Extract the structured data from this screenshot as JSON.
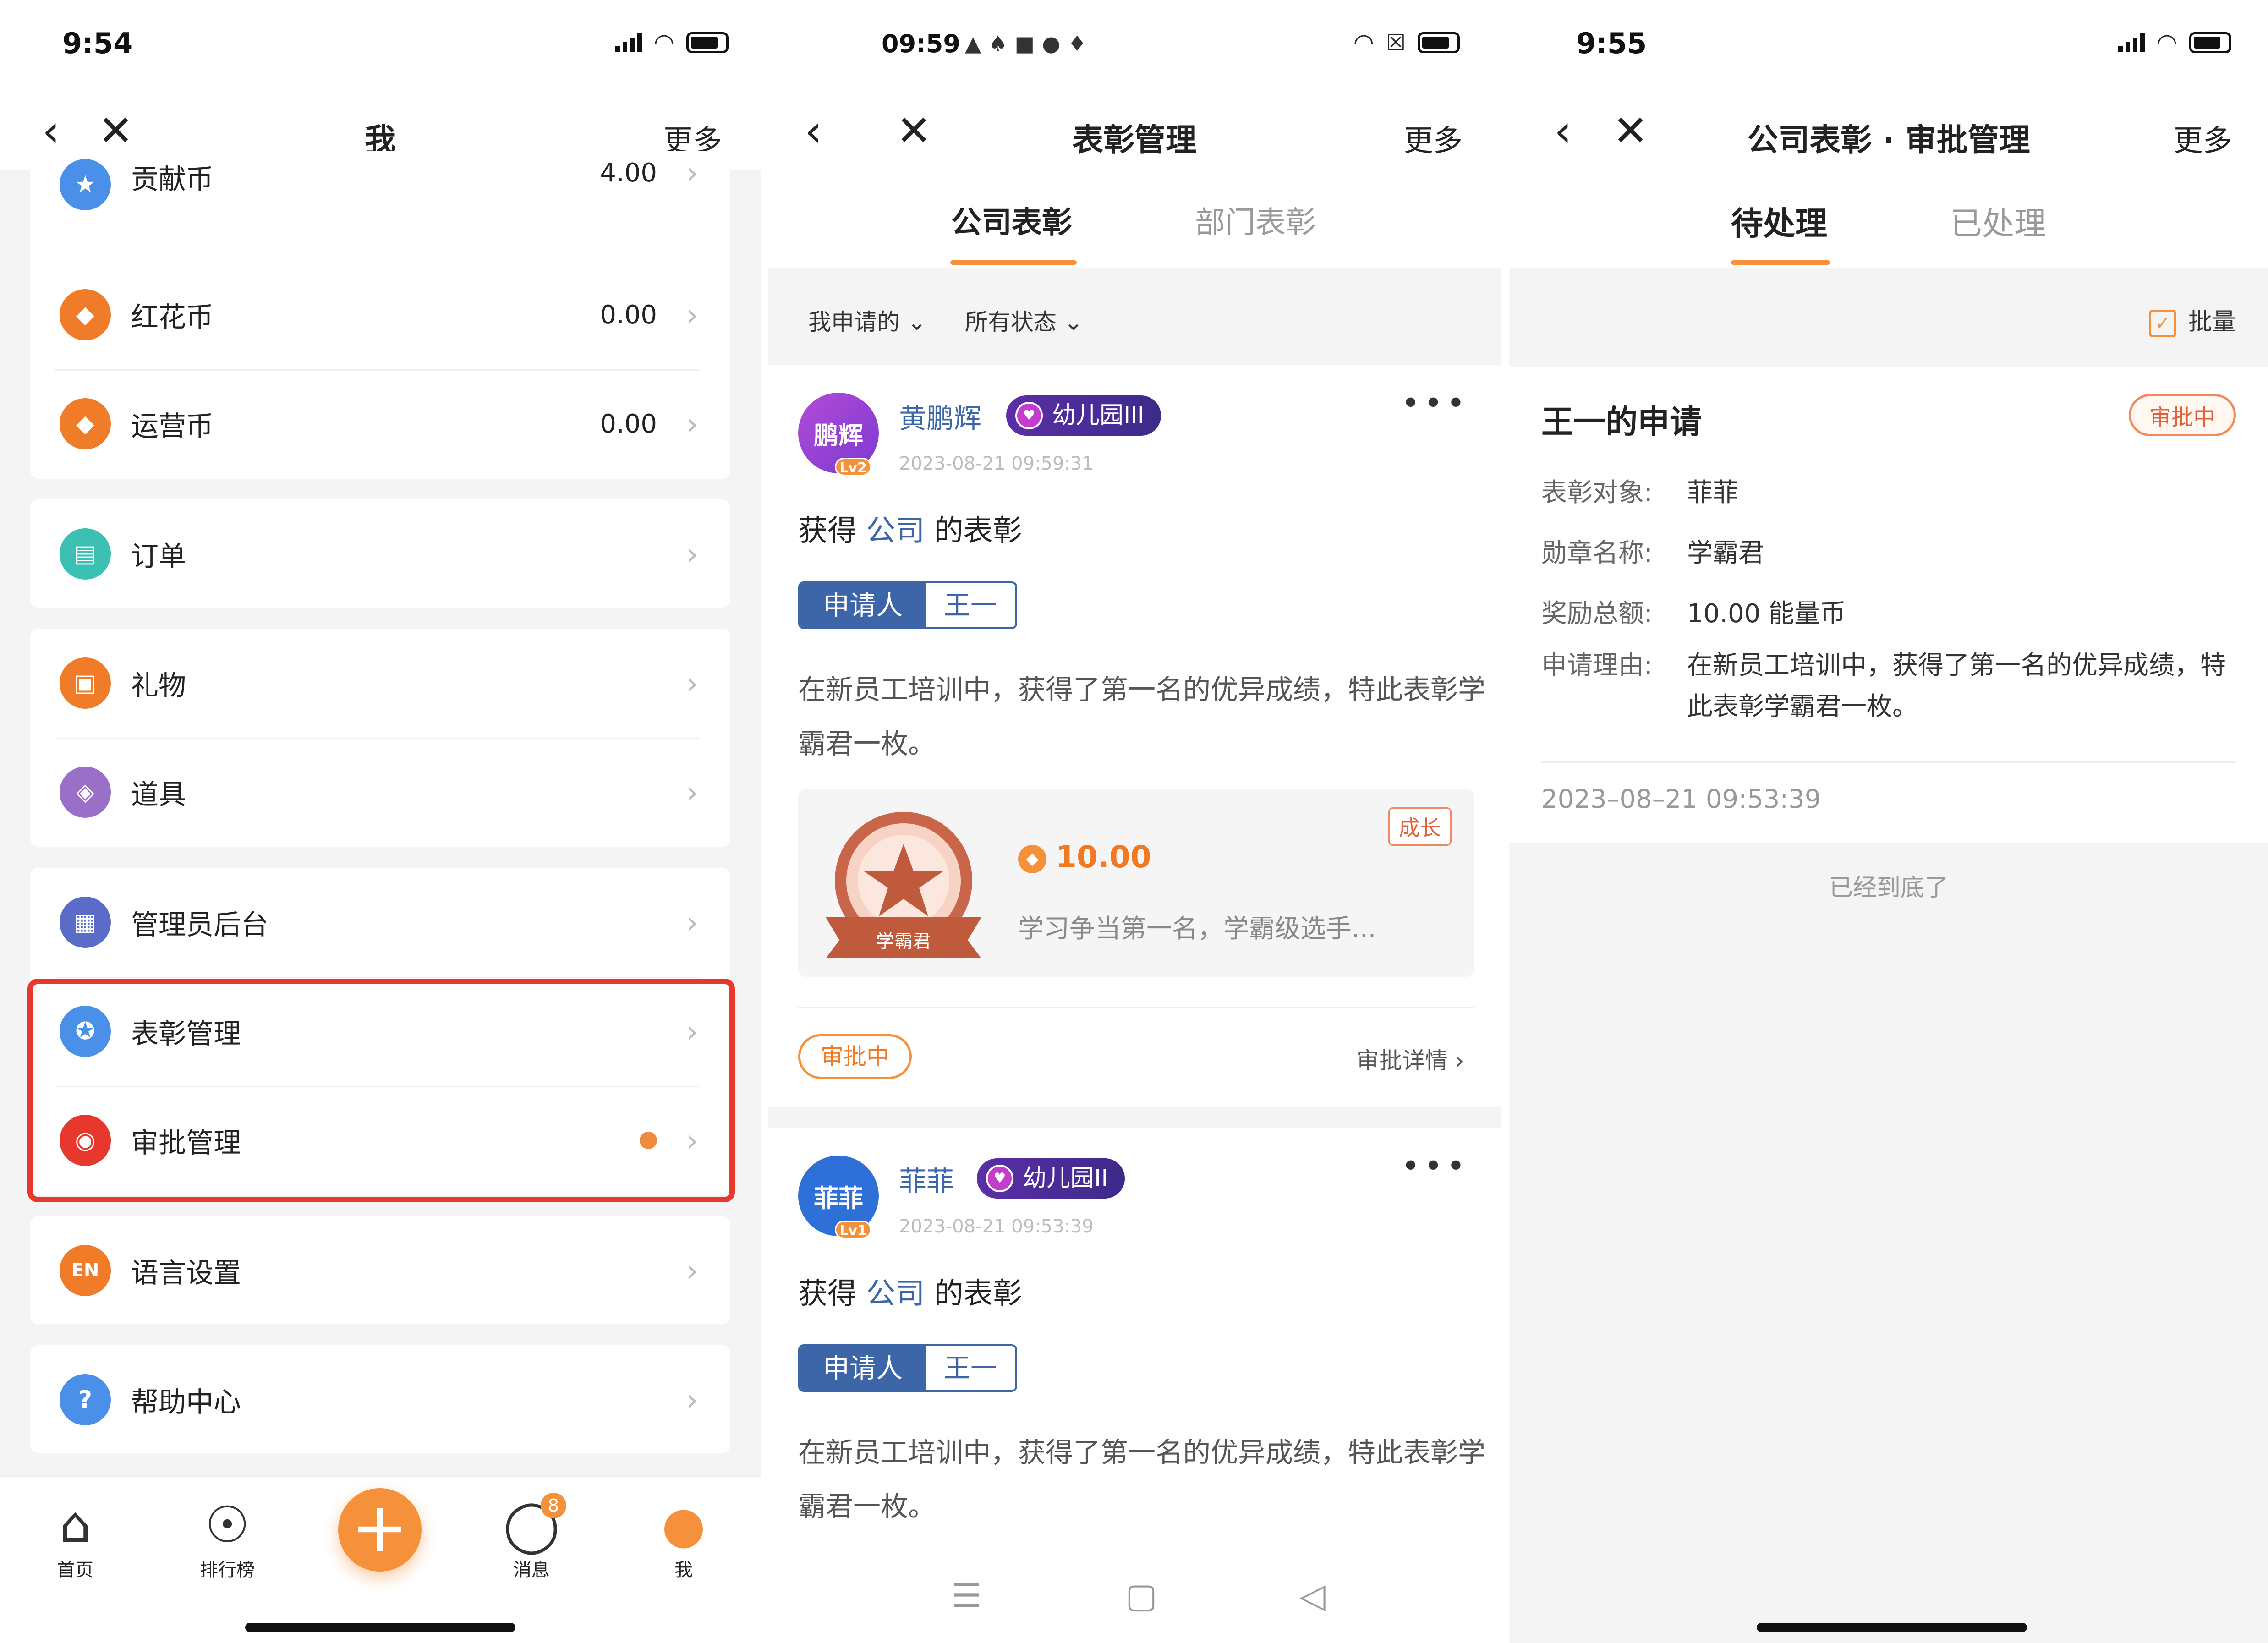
{
  "colors": {
    "accent": "#f5913a",
    "brand_blue": "#3d66a8",
    "highlight_red": "#e8382d"
  },
  "screen1": {
    "time": "9:54",
    "nav": {
      "title": "我",
      "more": "更多"
    },
    "rows": [
      {
        "label": "贡献币",
        "value": "4.00",
        "icon": "star-icon",
        "color": "#4a90e8"
      },
      {
        "label": "红花币",
        "value": "0.00",
        "icon": "diamond-icon",
        "color": "#f07c2a"
      },
      {
        "label": "运营币",
        "value": "0.00",
        "icon": "diamond-icon",
        "color": "#f07c2a"
      },
      {
        "label": "订单",
        "icon": "order-icon",
        "color": "#3cc0b4"
      },
      {
        "label": "礼物",
        "icon": "gift-icon",
        "color": "#f07c2a"
      },
      {
        "label": "道具",
        "icon": "prop-icon",
        "color": "#9a6fc8"
      },
      {
        "label": "管理员后台",
        "icon": "admin-icon",
        "color": "#5a6cc8"
      },
      {
        "label": "表彰管理",
        "icon": "medal-icon",
        "color": "#4a90e8"
      },
      {
        "label": "审批管理",
        "icon": "approval-icon",
        "color": "#e8382d"
      },
      {
        "label": "语言设置",
        "icon": "en-icon",
        "icon_text": "EN",
        "color": "#f07c2a"
      },
      {
        "label": "帮助中心",
        "icon": "help-icon",
        "icon_text": "?",
        "color": "#4a90e8"
      }
    ],
    "tabbar": {
      "home": "首页",
      "rank": "排行榜",
      "messages": "消息",
      "messages_badge": "8",
      "me": "我"
    }
  },
  "screen2": {
    "time": "09:59",
    "nav": {
      "title": "表彰管理",
      "more": "更多"
    },
    "tabs": [
      "公司表彰",
      "部门表彰"
    ],
    "filters": [
      "我申请的",
      "所有状态"
    ],
    "posts": [
      {
        "avatar_text": "鹏辉",
        "level": "Lv2",
        "name": "黄鹏辉",
        "badge": "幼儿园III",
        "date": "2023-08-21 09:59:31",
        "title_pre": "获得",
        "title_co": "公司",
        "title_post": "的表彰",
        "applicant_key": "申请人",
        "applicant_value": "王一",
        "desc": "在新员工培训中，获得了第一名的优异成绩，特此表彰学霸君一枚。",
        "medal_name": "学霸君",
        "tag": "成长",
        "coins": "10.00",
        "medal_desc": "学习争当第一名，学霸级选手...",
        "status": "审批中",
        "detail": "审批详情"
      },
      {
        "avatar_text": "菲菲",
        "level": "Lv1",
        "name": "菲菲",
        "badge": "幼儿园II",
        "date": "2023-08-21 09:53:39",
        "title_pre": "获得",
        "title_co": "公司",
        "title_post": "的表彰",
        "applicant_key": "申请人",
        "applicant_value": "王一",
        "desc": "在新员工培训中，获得了第一名的优异成绩，特此表彰学霸君一枚。"
      }
    ]
  },
  "screen3": {
    "time": "9:55",
    "nav": {
      "title": "公司表彰 · 审批管理",
      "more": "更多"
    },
    "tabs": [
      "待处理",
      "已处理"
    ],
    "batch": "批量",
    "request": {
      "title": "王一的申请",
      "status": "审批中",
      "target_key": "表彰对象:",
      "target_value": "菲菲",
      "medal_key": "勋章名称:",
      "medal_value": "学霸君",
      "reward_key": "奖励总额:",
      "reward_value": "10.00 能量币",
      "reason_key": "申请理由:",
      "reason_value": "在新员工培训中，获得了第一名的优异成绩，特此表彰学霸君一枚。",
      "date": "2023–08–21 09:53:39"
    },
    "end_text": "已经到底了"
  }
}
